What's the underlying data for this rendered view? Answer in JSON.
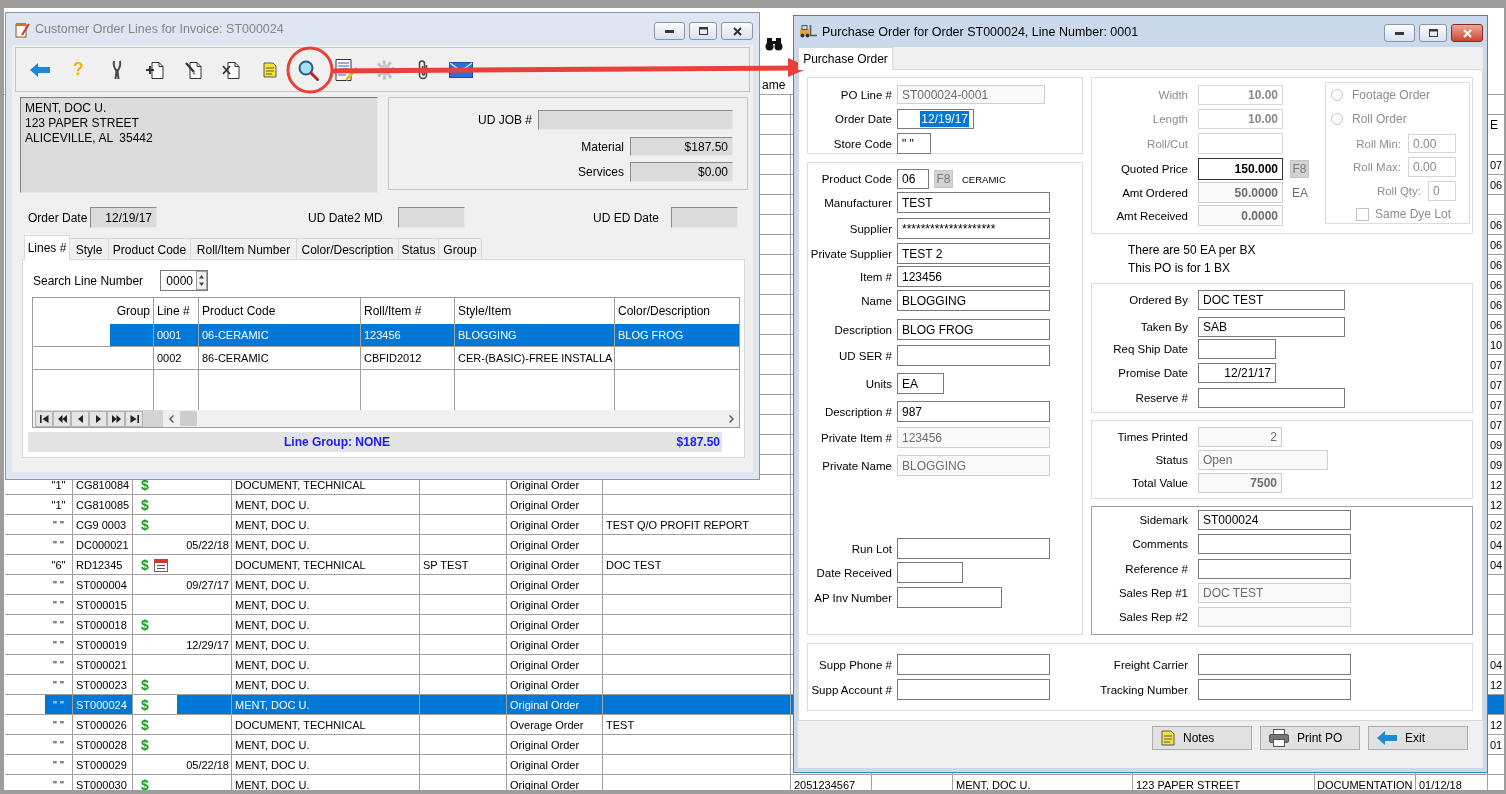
{
  "background_app": {
    "header": {
      "column_8": "ame",
      "column_15": "E"
    },
    "rows": [
      {
        "selected": false
      },
      {
        "selected": false
      },
      {
        "selected": false
      },
      {
        "selected": false,
        "column_15": "07"
      },
      {
        "selected": false,
        "column_15": "06"
      },
      {
        "selected": false
      },
      {
        "selected": false,
        "column_15": "06"
      },
      {
        "selected": false,
        "column_15": "06"
      },
      {
        "selected": false,
        "column_15": "06"
      },
      {
        "selected": false,
        "column_15": "06"
      },
      {
        "selected": false,
        "column_15": "06"
      },
      {
        "selected": false,
        "column_15": "06"
      },
      {
        "selected": false,
        "column_15": "10"
      },
      {
        "selected": false,
        "column_15": "07"
      },
      {
        "selected": false,
        "column_15": "07"
      },
      {
        "selected": false,
        "column_15": "07"
      },
      {
        "selected": false,
        "column_15": "07"
      },
      {
        "selected": false,
        "column_15": "09"
      },
      {
        "selected": false,
        "column_15": "09"
      },
      {
        "column_1": "\"1\"",
        "column_2": "CG810084",
        "column_3": "$",
        "calendar": false,
        "column_5": "DOCUMENT, TECHNICAL",
        "column_7": "Original Order",
        "column_15": "12",
        "selected": false
      },
      {
        "column_1": "\"1\"",
        "column_2": "CG810085",
        "column_3": "$",
        "calendar": false,
        "column_5": "MENT, DOC U.",
        "column_7": "Original Order",
        "column_15": "12",
        "selected": false
      },
      {
        "column_1": "\" \"",
        "column_2": "CG9 0003",
        "column_3": "$",
        "calendar": false,
        "column_5": "MENT, DOC U.",
        "column_7": "Original Order",
        "column_8": "TEST Q/O PROFIT REPORT",
        "column_15": "02",
        "selected": false
      },
      {
        "column_1": "\" \"",
        "column_2": "DC000021",
        "calendar": false,
        "column_4": "05/22/18",
        "column_5": "MENT, DOC U.",
        "column_7": "Original Order",
        "column_15": "04",
        "selected": false
      },
      {
        "column_1": "\"6\"",
        "column_2": "RD12345",
        "column_3": "$",
        "calendar": true,
        "column_5": "DOCUMENT, TECHNICAL",
        "column_6": "SP TEST",
        "column_7": "Original Order",
        "column_8": "DOC TEST",
        "column_15": "04",
        "selected": false
      },
      {
        "column_1": "\" \"",
        "column_2": "ST000004",
        "calendar": false,
        "column_4": "09/27/17",
        "column_5": "MENT, DOC U.",
        "column_7": "Original Order",
        "selected": false
      },
      {
        "column_1": "\" \"",
        "column_2": "ST000015",
        "calendar": false,
        "column_5": "MENT, DOC U.",
        "column_7": "Original Order",
        "selected": false
      },
      {
        "column_1": "\" \"",
        "column_2": "ST000018",
        "column_3": "$",
        "calendar": false,
        "column_5": "MENT, DOC U.",
        "column_7": "Original Order",
        "selected": false
      },
      {
        "column_1": "\" \"",
        "column_2": "ST000019",
        "calendar": false,
        "column_4": "12/29/17",
        "column_5": "MENT, DOC U.",
        "column_7": "Original Order",
        "selected": false
      },
      {
        "column_1": "\" \"",
        "column_2": "ST000021",
        "calendar": false,
        "column_5": "MENT, DOC U.",
        "column_7": "Original Order",
        "column_15": "04",
        "selected": false
      },
      {
        "column_1": "\" \"",
        "column_2": "ST000023",
        "column_3": "$",
        "calendar": false,
        "column_5": "MENT, DOC U.",
        "column_7": "Original Order",
        "column_15": "12",
        "selected": false
      },
      {
        "column_1": "\" \"",
        "column_2": "ST000024",
        "column_3": "$",
        "calendar": false,
        "column_5": "MENT, DOC U.",
        "column_7": "Original Order",
        "selected": true
      },
      {
        "column_1": "\" \"",
        "column_2": "ST000026",
        "column_3": "$",
        "calendar": false,
        "column_5": "DOCUMENT, TECHNICAL",
        "column_7": "Overage Order",
        "column_8": "TEST",
        "column_15": "12",
        "selected": false
      },
      {
        "column_1": "\" \"",
        "column_2": "ST000028",
        "column_3": "$",
        "calendar": false,
        "column_5": "MENT, DOC U.",
        "column_7": "Original Order",
        "column_15": "01",
        "selected": false
      },
      {
        "column_1": "\" \"",
        "column_2": "ST000029",
        "calendar": false,
        "column_4": "05/22/18",
        "column_5": "MENT, DOC U.",
        "column_7": "Original Order",
        "selected": false
      },
      {
        "column_1": "\" \"",
        "column_2": "ST000030",
        "column_3": "$",
        "calendar": false,
        "column_5": "MENT, DOC U.",
        "column_7": "Original Order",
        "column_9": "2051234567",
        "column_11": "MENT, DOC U.",
        "column_12": "123 PAPER STREET",
        "column_13": "DOCUMENTATION",
        "column_14": "01/12/18",
        "selected": false
      }
    ]
  },
  "order_lines_window": {
    "title": "Customer Order Lines for Invoice: ST000024",
    "active": false,
    "toolbar": [
      {
        "kind": "back",
        "disabled": false
      },
      {
        "kind": "help",
        "glyph": "?",
        "disabled": false
      },
      {
        "kind": "tools",
        "disabled": false
      },
      {
        "kind": "add",
        "disabled": false
      },
      {
        "kind": "edit",
        "disabled": false
      },
      {
        "kind": "delete",
        "disabled": false
      },
      {
        "kind": "note",
        "disabled": false
      },
      {
        "kind": "search",
        "disabled": false
      },
      {
        "kind": "report",
        "disabled": false
      },
      {
        "kind": "gear",
        "disabled": true
      },
      {
        "kind": "attach",
        "disabled": false
      },
      {
        "kind": "mail",
        "disabled": false
      }
    ],
    "address": [
      "MENT, DOC U.",
      "123 PAPER STREET",
      "ALICEVILLE, AL  35442"
    ],
    "summary": [
      {
        "label": "UD JOB #"
      },
      {
        "label": "Material",
        "value": "$187.50"
      },
      {
        "label": "Services",
        "value": "$0.00"
      }
    ],
    "dates": [
      {
        "label": "Order Date",
        "value": "12/19/17"
      },
      {
        "label": "UD Date2 MD"
      },
      {
        "label": "UD ED Date"
      }
    ],
    "tabs": [
      {
        "label": "Lines #",
        "selected": true
      },
      {
        "label": "Style",
        "selected": false
      },
      {
        "label": "Product Code",
        "selected": false
      },
      {
        "label": "Roll/Item Number",
        "selected": false
      },
      {
        "label": "Color/Description",
        "selected": false
      },
      {
        "label": "Status",
        "selected": false
      },
      {
        "label": "Group",
        "selected": false
      }
    ],
    "search": {
      "label": "Search Line Number",
      "value": "0000"
    },
    "grid": {
      "columns": [
        "Group",
        "Line #",
        "Product Code",
        "Roll/Item #",
        "Style/Item",
        "Color/Description"
      ],
      "rows": [
        {
          "line": "0001",
          "product_code": "06-CERAMIC",
          "roll_item": "123456",
          "style_item": "BLOGGING",
          "color_description": "BLOG FROG",
          "selected": true
        },
        {
          "line": "0002",
          "product_code": "86-CERAMIC",
          "roll_item": "CBFID2012",
          "style_item": "CER-(BASIC)-FREE INSTALLA",
          "selected": false
        }
      ]
    },
    "footer": {
      "line_group": "Line Group: NONE",
      "total": "$187.50"
    }
  },
  "po_window": {
    "title": "Purchase Order for Order ST000024, Line Number: 0001",
    "active": true,
    "tabs": [
      {
        "label": "Purchase Order",
        "selected": true
      }
    ],
    "order_fields": [
      {
        "label": "PO Line #",
        "value": "ST000024-0001",
        "disabled": false,
        "read_only": true,
        "text_selected": false
      },
      {
        "label": "Order Date",
        "value": "12/19/17",
        "disabled": false,
        "read_only": false,
        "text_selected": true
      },
      {
        "label": "Store Code",
        "value": "\" \"",
        "disabled": false,
        "read_only": false,
        "text_selected": false
      }
    ],
    "product": {
      "product_code": {
        "label": "Product Code",
        "value": "06",
        "lookup": "F8",
        "description": "CERAMIC"
      },
      "fields": [
        {
          "label": "Manufacturer",
          "value": "TEST",
          "disabled": false,
          "read_only": false
        },
        {
          "label": "Supplier",
          "value": "********************",
          "disabled": false,
          "read_only": false
        },
        {
          "label": "Private Supplier",
          "value": "TEST 2",
          "disabled": false,
          "read_only": false
        },
        {
          "label": "Item #",
          "value": "123456",
          "disabled": false,
          "read_only": false
        },
        {
          "label": "Name",
          "value": "BLOGGING",
          "disabled": false,
          "read_only": false
        },
        {
          "label": "Description",
          "value": "BLOG FROG",
          "disabled": false,
          "read_only": false
        },
        {
          "label": "UD SER #",
          "disabled": false,
          "read_only": false
        },
        {
          "label": "Units",
          "value": "EA",
          "disabled": false,
          "read_only": false
        },
        {
          "label": "Description #",
          "value": "987",
          "disabled": false,
          "read_only": false
        },
        {
          "label": "Private Item #",
          "value": "123456",
          "disabled": false,
          "read_only": true
        },
        {
          "label": "Private Name",
          "value": "BLOGGING",
          "disabled": false,
          "read_only": true
        }
      ],
      "receiving_fields": [
        {
          "label": "Run Lot",
          "disabled": false,
          "read_only": false
        },
        {
          "label": "Date Received",
          "disabled": false,
          "read_only": false
        },
        {
          "label": "AP Inv Number",
          "disabled": false,
          "read_only": false
        }
      ]
    },
    "pricing": {
      "fields": [
        {
          "label": "Width",
          "value": "10.00",
          "disabled": true,
          "read_only": false
        },
        {
          "label": "Length",
          "value": "10.00",
          "disabled": true,
          "read_only": false
        },
        {
          "label": "Roll/Cut",
          "disabled": true,
          "read_only": false
        },
        {
          "label": "Quoted Price",
          "value": "150.000",
          "lookup": "F8",
          "disabled": false,
          "read_only": false
        },
        {
          "label": "Amt Ordered",
          "value": "50.0000",
          "unit": "EA",
          "disabled": false,
          "read_only": true
        },
        {
          "label": "Amt Received",
          "value": "0.0000",
          "disabled": false,
          "read_only": true
        }
      ],
      "roll_options": [
        {
          "kind": "radio",
          "label": "Footage Order",
          "checked": false,
          "disabled": true
        },
        {
          "kind": "radio",
          "label": "Roll Order",
          "checked": false,
          "disabled": true
        },
        {
          "kind": "number",
          "label": "Roll Min:",
          "value": "0.00",
          "disabled": true
        },
        {
          "kind": "number",
          "label": "Roll Max:",
          "value": "0.00",
          "disabled": true
        },
        {
          "kind": "number",
          "label": "Roll Qty:",
          "value": "0",
          "disabled": true
        },
        {
          "kind": "checkbox",
          "label": "Same Dye Lot",
          "checked": false,
          "disabled": true
        }
      ]
    },
    "packaging_notes": [
      "There are 50 EA per BX",
      "This PO is for 1 BX"
    ],
    "ordering": [
      {
        "label": "Ordered By",
        "value": "DOC TEST",
        "disabled": false,
        "read_only": false
      },
      {
        "label": "Taken By",
        "value": "SAB",
        "disabled": false,
        "read_only": false
      },
      {
        "label": "Req Ship Date",
        "disabled": false,
        "read_only": false
      },
      {
        "label": "Promise Date",
        "value": "12/21/17",
        "disabled": false,
        "read_only": false
      },
      {
        "label": "Reserve #",
        "disabled": false,
        "read_only": false
      }
    ],
    "printing": [
      {
        "label": "Times Printed",
        "value": "2",
        "disabled": false,
        "read_only": true
      },
      {
        "label": "Status",
        "value": "Open",
        "disabled": false,
        "read_only": true
      },
      {
        "label": "Total Value",
        "value": "7500",
        "disabled": false,
        "read_only": true
      }
    ],
    "references": [
      {
        "label": "Sidemark",
        "value": "ST000024",
        "disabled": false,
        "read_only": false
      },
      {
        "label": "Comments",
        "disabled": false,
        "read_only": false
      },
      {
        "label": "Reference #",
        "disabled": false,
        "read_only": false
      },
      {
        "label": "Sales Rep #1",
        "value": "DOC TEST",
        "disabled": false,
        "read_only": true
      },
      {
        "label": "Sales Rep #2",
        "disabled": false,
        "read_only": true
      }
    ],
    "shipping": {
      "supplier": [
        {
          "label": "Supp Phone #",
          "disabled": false,
          "read_only": false
        },
        {
          "label": "Supp Account #",
          "disabled": false,
          "read_only": false
        }
      ],
      "carrier": [
        {
          "label": "Freight Carrier",
          "disabled": false,
          "read_only": false
        },
        {
          "label": "Tracking Number",
          "disabled": false,
          "read_only": false
        }
      ]
    },
    "buttons": [
      {
        "kind": "notes",
        "label": "Notes"
      },
      {
        "kind": "print",
        "label": "Print PO"
      },
      {
        "kind": "exit",
        "label": "Exit"
      }
    ]
  },
  "annotations": [
    {
      "kind": "circle"
    },
    {
      "kind": "arrow"
    }
  ]
}
